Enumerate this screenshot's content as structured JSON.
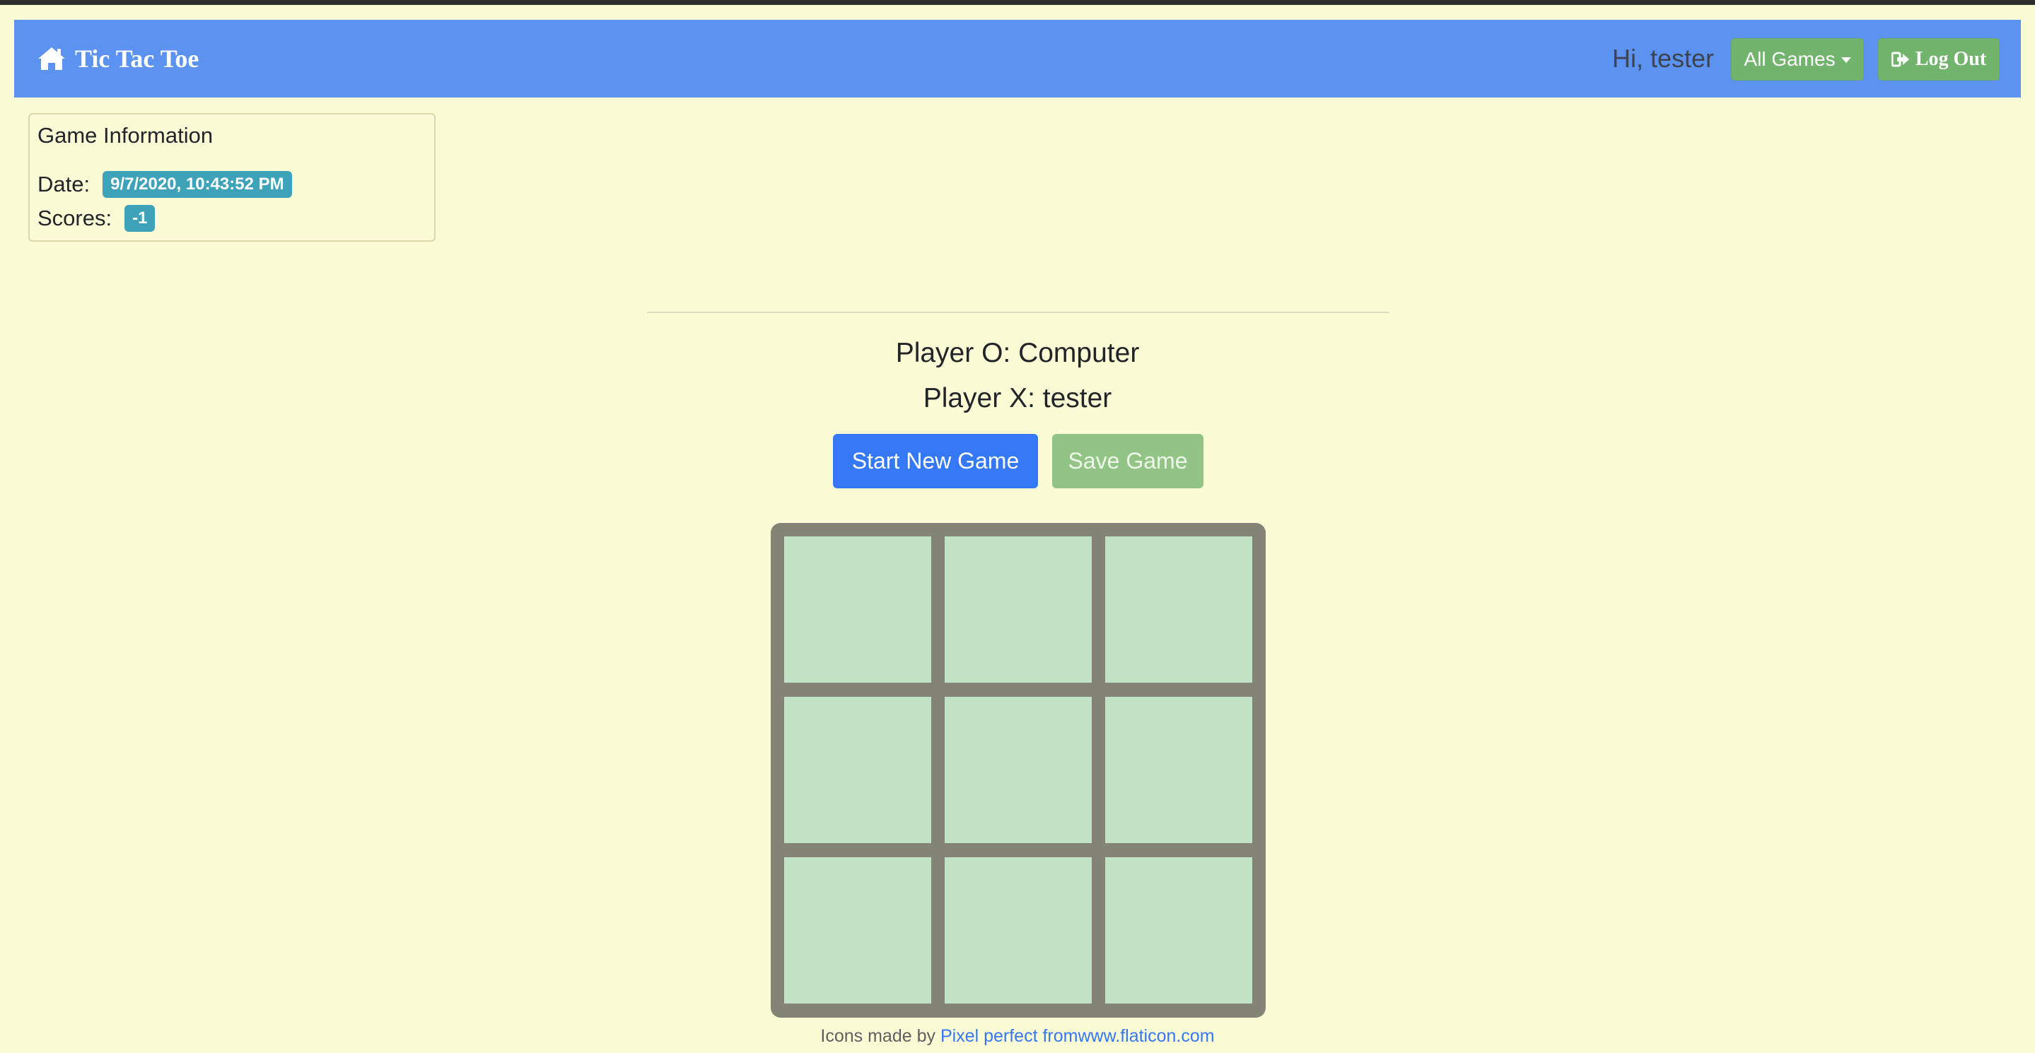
{
  "navbar": {
    "brand": "Tic Tac Toe",
    "greeting": "Hi, tester",
    "all_games_label": "All Games",
    "logout_label": "Log Out",
    "brand_icon": "home-icon",
    "logout_icon": "sign-out-icon",
    "background_color": "#5c93f0",
    "button_color": "#72b46e"
  },
  "game_info": {
    "title": "Game Information",
    "date_label": "Date:",
    "date_value": "9/7/2020, 10:43:52 PM",
    "scores_label": "Scores:",
    "scores_value": "-1",
    "badge_color": "#3ea2b8"
  },
  "players": {
    "o_line": "Player O: Computer",
    "x_line": "Player X: tester"
  },
  "actions": {
    "start_label": "Start New Game",
    "save_label": "Save Game"
  },
  "board": {
    "cells": [
      "",
      "",
      "",
      "",
      "",
      "",
      "",
      "",
      ""
    ],
    "cell_color": "#c2e2c6",
    "frame_color": "#838376"
  },
  "footer": {
    "prefix": "Icons made by",
    "link_label": "Pixel perfect fromwww.flaticon.com"
  },
  "page": {
    "background_color": "#fbfbd6"
  }
}
